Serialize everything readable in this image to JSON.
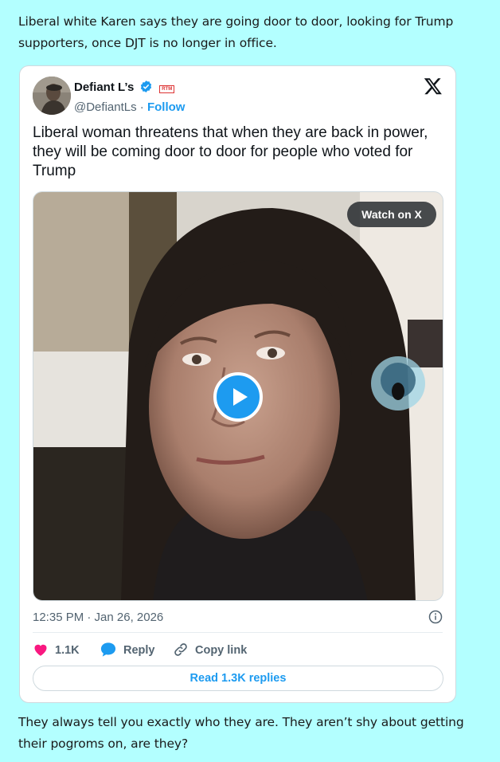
{
  "post": {
    "intro_text": "Liberal white Karen says they are going door to door, looking for Trump supporters, once DJT is no longer in office.",
    "outro_text": "They always tell you exactly who they are. They aren’t shy about getting their pogroms on, are they?"
  },
  "embed": {
    "author_name": "Defiant L’s",
    "author_handle": "@DefiantLs",
    "separator": "·",
    "follow_label": "Follow",
    "rtm_badge": "RTM",
    "tweet_text": "Liberal woman threatens that when they are back in power, they will be coming door to door for people who voted for Trump",
    "watch_label": "Watch on X",
    "timestamp": "12:35 PM · Jan 26, 2026",
    "like_count": "1.1K",
    "reply_label": "Reply",
    "copy_link_label": "Copy link",
    "read_replies_label": "Read 1.3K replies"
  },
  "icons": {
    "verified": "verified-badge-icon",
    "x_logo": "x-logo-icon",
    "play": "play-icon",
    "info": "info-icon",
    "like": "heart-icon",
    "reply": "reply-bubble-icon",
    "copy_link": "link-icon"
  },
  "colors": {
    "page_background": "#b3ffff",
    "accent_blue": "#1d9bf0",
    "like_pink": "#f91880",
    "secondary_text": "#536471"
  }
}
